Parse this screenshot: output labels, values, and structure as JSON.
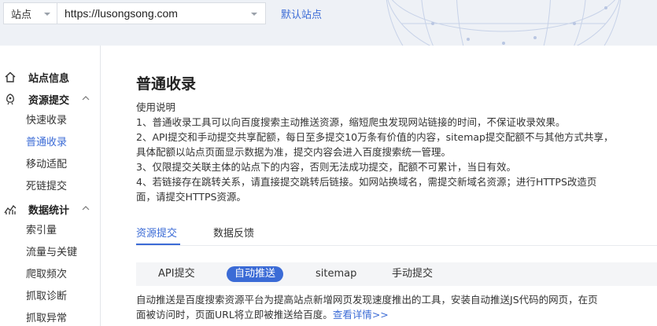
{
  "header": {
    "site_select_label": "站点",
    "url_value": "https://lusongsong.com",
    "default_site_label": "默认站点"
  },
  "sidebar": {
    "groups": [
      {
        "label": "站点信息",
        "icon": "home-icon",
        "items": []
      },
      {
        "label": "资源提交",
        "icon": "upload-icon",
        "expanded": true,
        "items": [
          "快速收录",
          "普通收录",
          "移动适配",
          "死链提交"
        ],
        "active_item": "普通收录"
      },
      {
        "label": "数据统计",
        "icon": "chart-icon",
        "expanded": true,
        "items": [
          "索引量",
          "流量与关键",
          "爬取频次",
          "抓取诊断",
          "抓取异常"
        ]
      }
    ]
  },
  "main": {
    "title": "普通收录",
    "description": [
      "使用说明",
      "1、普通收录工具可以向百度搜索主动推送资源，缩短爬虫发现网站链接的时间，不保证收录效果。",
      "2、API提交和手动提交共享配额，每日至多提交10万条有价值的内容，sitemap提交配额不与其他方式共享，",
      "具体配额以站点页面显示数据为准，提交内容会进入百度搜索统一管理。",
      "3、仅限提交关联主体的站点下的内容，否则无法成功提交，配额不可累计，当日有效。",
      "4、若链接存在跳转关系，请直接提交跳转后链接。如网站换域名，需提交新域名资源；进行HTTPS改造页",
      "面，请提交HTTPS资源。"
    ],
    "tabs": [
      "资源提交",
      "数据反馈"
    ],
    "active_tab": "资源提交",
    "subtabs": [
      "API提交",
      "自动推送",
      "sitemap",
      "手动提交"
    ],
    "active_subtab": "自动推送",
    "auto_push_desc": {
      "line1": "自动推送是百度搜索资源平台为提高站点新增网页发现速度推出的工具，安装自动推送JS代码的网页，在页",
      "line2": "面被访问时，页面URL将立即被推送给百度。",
      "link": "查看详情>>"
    }
  },
  "colors": {
    "accent": "#3b6bd6",
    "header_bg": "#eef1f6"
  }
}
